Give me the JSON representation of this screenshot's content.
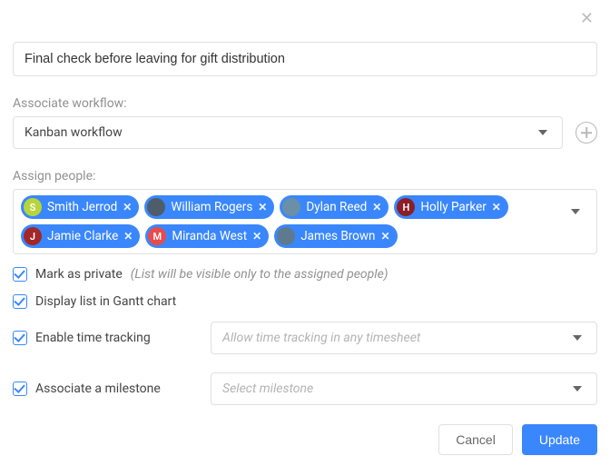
{
  "title": "Final check before leaving for gift distribution",
  "labels": {
    "associate_workflow": "Associate workflow:",
    "assign_people": "Assign people:"
  },
  "workflow": {
    "selected": "Kanban workflow"
  },
  "people": [
    {
      "name": "Smith Jerrod",
      "avatar_bg": "#b8d43b",
      "avatar_text": "S",
      "avatar_type": "initial"
    },
    {
      "name": "William Rogers",
      "avatar_bg": "#4f5d6a",
      "avatar_text": "",
      "avatar_type": "photo"
    },
    {
      "name": "Dylan Reed",
      "avatar_bg": "#6b8fa6",
      "avatar_text": "",
      "avatar_type": "photo"
    },
    {
      "name": "Holly Parker",
      "avatar_bg": "#8a1f28",
      "avatar_text": "H",
      "avatar_type": "initial"
    },
    {
      "name": "Jamie Clarke",
      "avatar_bg": "#a22727",
      "avatar_text": "J",
      "avatar_type": "initial"
    },
    {
      "name": "Miranda West",
      "avatar_bg": "#e94b4b",
      "avatar_text": "M",
      "avatar_type": "initial"
    },
    {
      "name": "James Brown",
      "avatar_bg": "#5e7a8f",
      "avatar_text": "",
      "avatar_type": "photo"
    }
  ],
  "options": {
    "private": {
      "checked": true,
      "label": "Mark as private",
      "hint": "(List will be visible only to the assigned people)"
    },
    "gantt": {
      "checked": true,
      "label": "Display list in Gantt chart"
    },
    "time_tracking": {
      "checked": true,
      "label": "Enable time tracking",
      "placeholder": "Allow time tracking in any timesheet"
    },
    "milestone": {
      "checked": true,
      "label": "Associate a milestone",
      "placeholder": "Select milestone"
    }
  },
  "buttons": {
    "cancel": "Cancel",
    "update": "Update"
  }
}
